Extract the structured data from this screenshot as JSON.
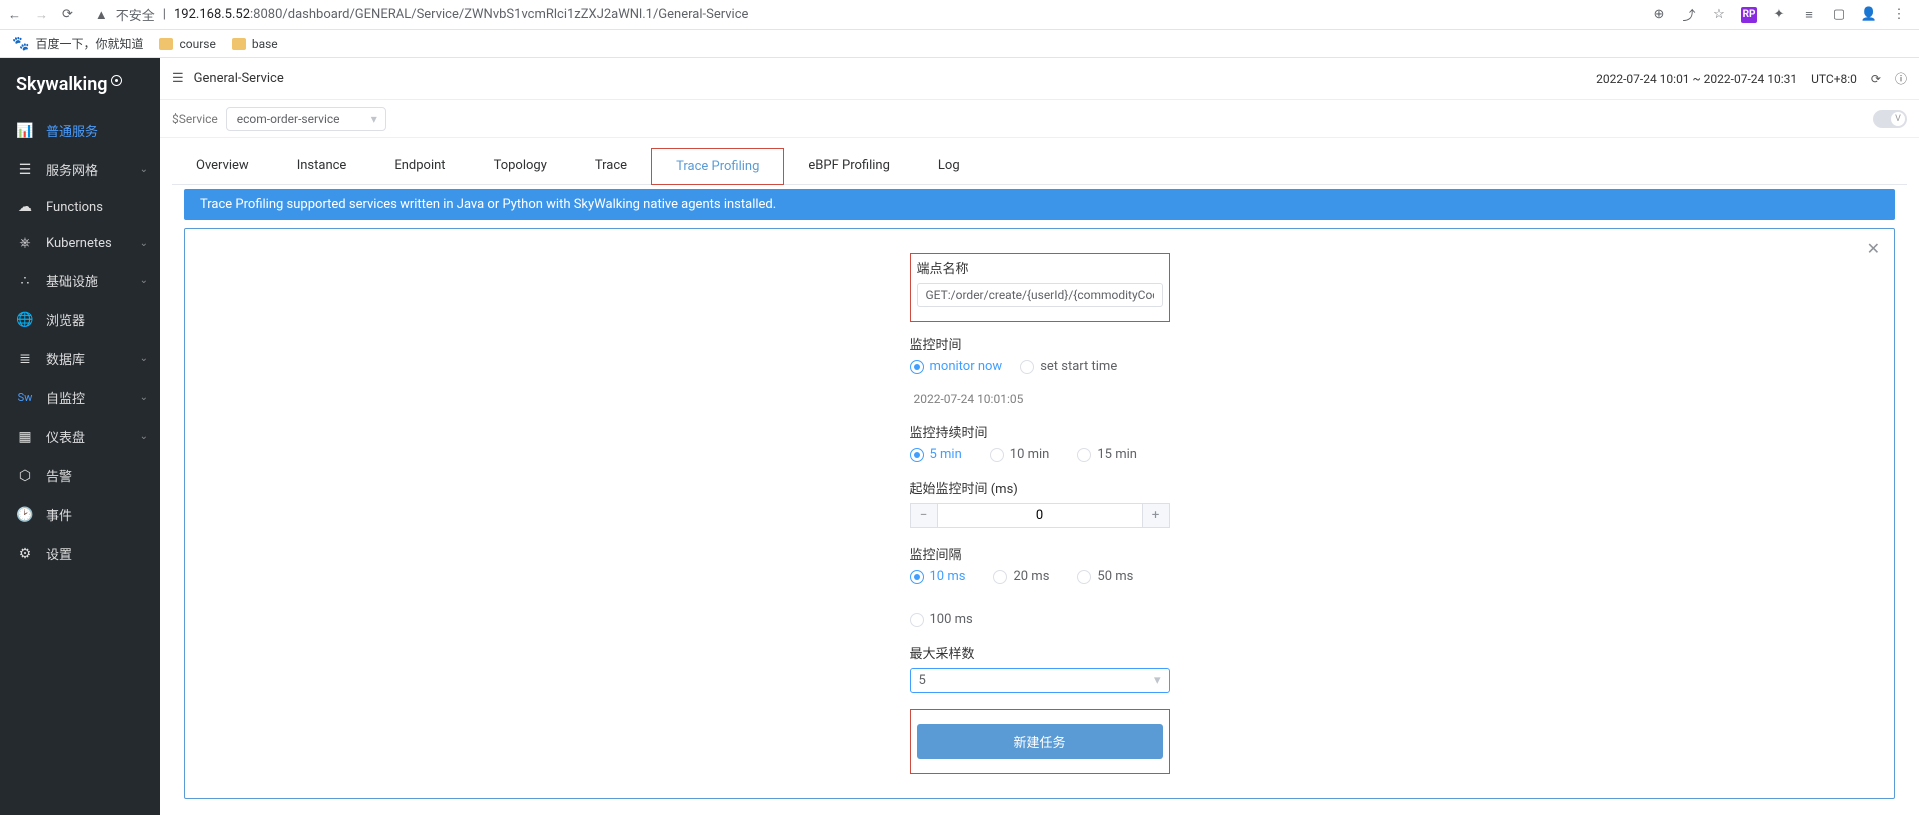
{
  "browser": {
    "insecure_label": "不安全",
    "url_host": "192.168.5.52",
    "url_port": ":8080",
    "url_path": "/dashboard/GENERAL/Service/ZWNvbS1vcmRlci1zZXJ2aWNl.1/General-Service"
  },
  "bookmarks": {
    "baidu": "百度一下，你就知道",
    "course": "course",
    "base": "base"
  },
  "sidebar": {
    "items": [
      {
        "label": "普通服务"
      },
      {
        "label": "服务网格"
      },
      {
        "label": "Functions"
      },
      {
        "label": "Kubernetes"
      },
      {
        "label": "基础设施"
      },
      {
        "label": "浏览器"
      },
      {
        "label": "数据库"
      },
      {
        "label": "自监控"
      },
      {
        "label": "仪表盘"
      },
      {
        "label": "告警"
      },
      {
        "label": "事件"
      },
      {
        "label": "设置"
      }
    ]
  },
  "topbar": {
    "title": "General-Service",
    "time_range": "2022-07-24 10:01 ~ 2022-07-24 10:31",
    "utc": "UTC+8:0"
  },
  "service": {
    "label": "$Service",
    "value": "ecom-order-service",
    "toggle_label": "V"
  },
  "tabs": {
    "items": [
      "Overview",
      "Instance",
      "Endpoint",
      "Topology",
      "Trace",
      "Trace Profiling",
      "eBPF Profiling",
      "Log"
    ]
  },
  "banner": "Trace Profiling supported services written in Java or Python with SkyWalking native agents installed.",
  "form": {
    "endpoint_label": "端点名称",
    "endpoint_value": "GET:/order/create/{userId}/{commodityCode}/{cou",
    "monitor_time_label": "监控时间",
    "monitor_now": "monitor now",
    "set_start_time": "set start time",
    "start_time_hint": "2022-07-24 10:01:05",
    "duration_label": "监控持续时间",
    "duration_opts": [
      "5 min",
      "10 min",
      "15 min"
    ],
    "threshold_label": "起始监控时间 (ms)",
    "threshold_value": "0",
    "interval_label": "监控间隔",
    "interval_opts": [
      "10 ms",
      "20 ms",
      "50 ms",
      "100 ms"
    ],
    "max_samples_label": "最大采样数",
    "max_samples_value": "5",
    "submit": "新建任务"
  }
}
